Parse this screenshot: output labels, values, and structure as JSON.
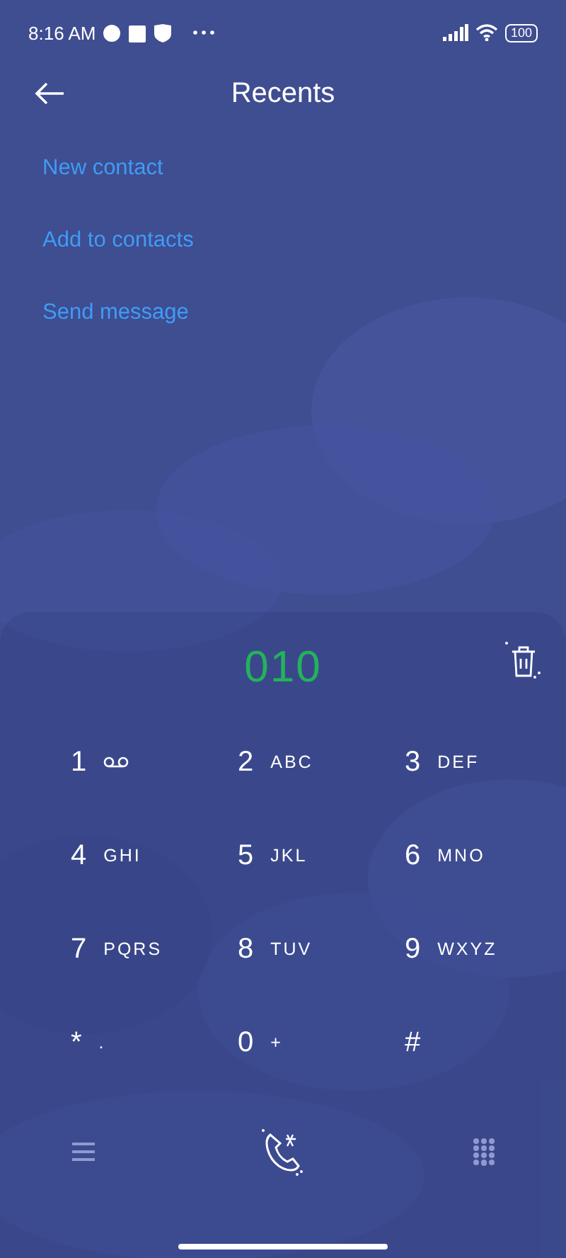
{
  "status_bar": {
    "time": "8:16 AM",
    "battery": "100"
  },
  "header": {
    "title": "Recents"
  },
  "actions": [
    {
      "label": "New contact"
    },
    {
      "label": "Add to contacts"
    },
    {
      "label": "Send message"
    }
  ],
  "dialer": {
    "number": "010",
    "keys": [
      {
        "digit": "1",
        "kind": "voicemail"
      },
      {
        "digit": "2",
        "letters": "ABC",
        "kind": "letters"
      },
      {
        "digit": "3",
        "letters": "DEF",
        "kind": "letters"
      },
      {
        "digit": "4",
        "letters": "GHI",
        "kind": "letters"
      },
      {
        "digit": "5",
        "letters": "JKL",
        "kind": "letters"
      },
      {
        "digit": "6",
        "letters": "MNO",
        "kind": "letters"
      },
      {
        "digit": "7",
        "letters": "PQRS",
        "kind": "letters"
      },
      {
        "digit": "8",
        "letters": "TUV",
        "kind": "letters"
      },
      {
        "digit": "9",
        "letters": "WXYZ",
        "kind": "letters"
      },
      {
        "digit": "*",
        "letters": ".",
        "kind": "letters"
      },
      {
        "digit": "0",
        "letters": "+",
        "kind": "letters"
      },
      {
        "digit": "#",
        "kind": "plain"
      }
    ]
  }
}
